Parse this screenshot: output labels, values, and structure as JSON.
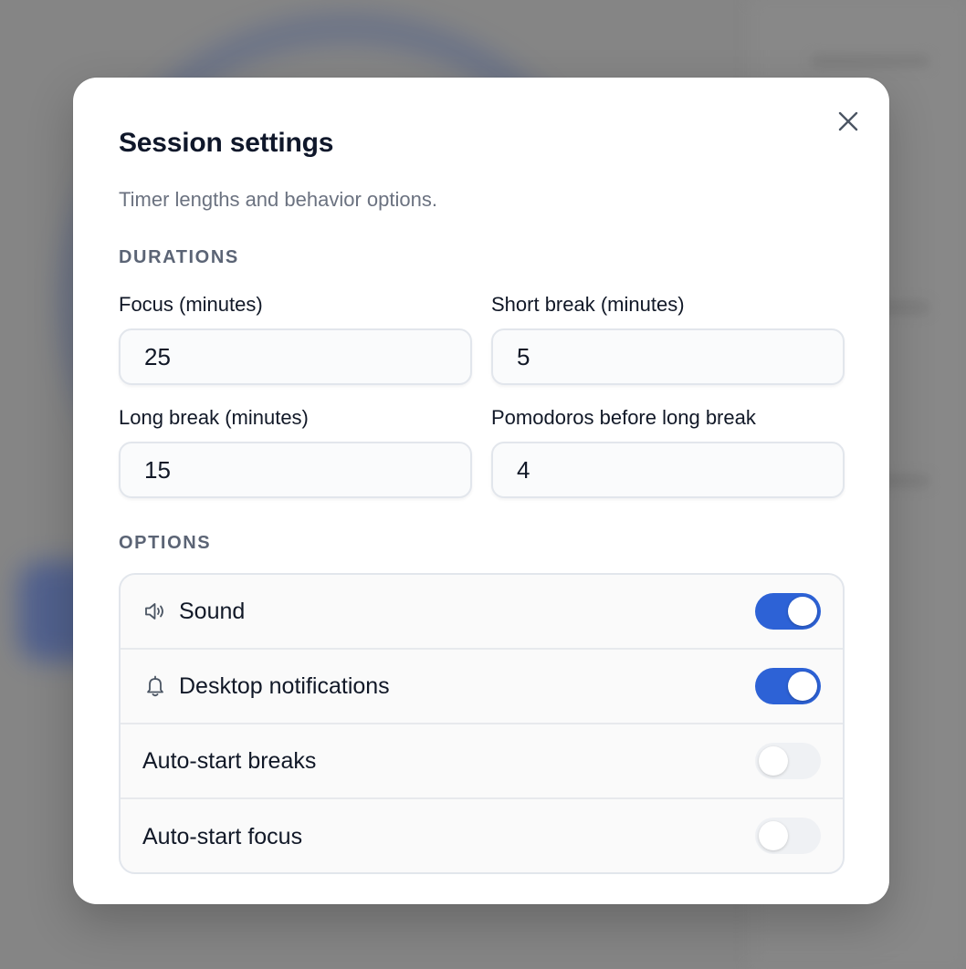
{
  "modal": {
    "title": "Session settings",
    "subtitle": "Timer lengths and behavior options.",
    "close_icon": "close-icon"
  },
  "durations": {
    "section_label": "DURATIONS",
    "focus": {
      "label": "Focus (minutes)",
      "value": "25"
    },
    "short_break": {
      "label": "Short break (minutes)",
      "value": "5"
    },
    "long_break": {
      "label": "Long break (minutes)",
      "value": "15"
    },
    "pomodoros": {
      "label": "Pomodoros before long break",
      "value": "4"
    }
  },
  "options": {
    "section_label": "OPTIONS",
    "items": [
      {
        "label": "Sound",
        "icon": "speaker-icon",
        "enabled": true
      },
      {
        "label": "Desktop notifications",
        "icon": "bell-icon",
        "enabled": true
      },
      {
        "label": "Auto-start breaks",
        "icon": "",
        "enabled": false
      },
      {
        "label": "Auto-start focus",
        "icon": "",
        "enabled": false
      }
    ]
  },
  "colors": {
    "accent": "#2d62d6",
    "toggle_off": "#eff1f4",
    "title": "#0f172a",
    "muted": "#6b7280"
  }
}
